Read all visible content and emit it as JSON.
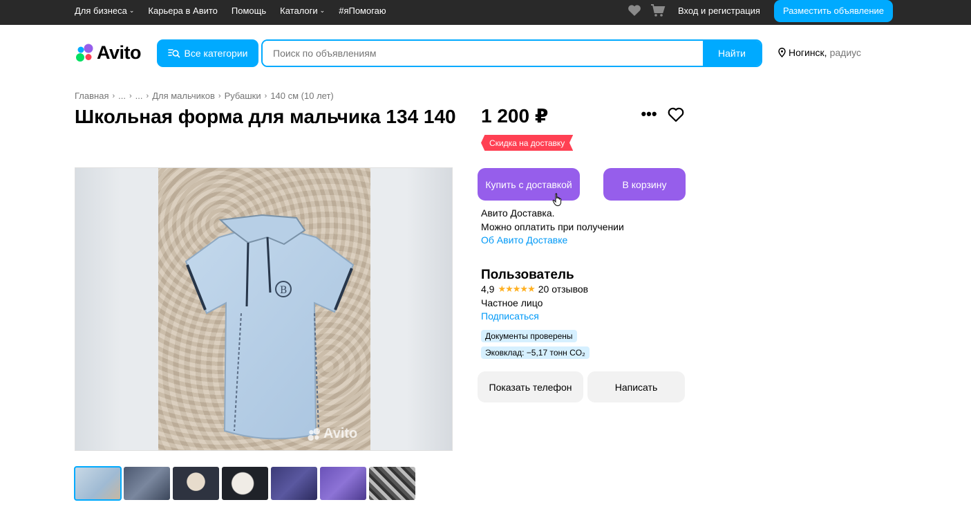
{
  "topbar": {
    "nav": [
      {
        "label": "Для бизнеса",
        "has_dropdown": true
      },
      {
        "label": "Карьера в Авито",
        "has_dropdown": false
      },
      {
        "label": "Помощь",
        "has_dropdown": false
      },
      {
        "label": "Каталоги",
        "has_dropdown": true
      },
      {
        "label": "#яПомогаю",
        "has_dropdown": false
      }
    ],
    "favorites_icon": "heart-icon",
    "cart_icon": "cart-icon",
    "login_label": "Вход и регистрация",
    "post_ad_label": "Разместить объявление"
  },
  "header": {
    "logo_text": "Avito",
    "categories_label": "Все категории",
    "search_placeholder": "Поиск по объявлениям",
    "search_button": "Найти",
    "location_city": "Ногинск,",
    "location_radius": "радиус"
  },
  "breadcrumbs": [
    "Главная",
    "...",
    "...",
    "Для мальчиков",
    "Рубашки",
    "140 см (10 лет)"
  ],
  "listing": {
    "title": "Школьная форма для мальчика 134 140",
    "watermark": "Avito",
    "thumbnail_count": 7
  },
  "offer": {
    "price": "1 200 ₽",
    "discount_badge": "Скидка на доставку",
    "buy_button": "Купить с доставкой",
    "cart_button": "В корзину",
    "delivery_line1": "Авито Доставка.",
    "delivery_line2": "Можно оплатить при получении",
    "delivery_link": "Об Авито Доставке"
  },
  "seller": {
    "name": "Пользователь",
    "rating": "4,9",
    "stars": "★★★★★",
    "reviews": "20 отзывов",
    "type": "Частное лицо",
    "subscribe": "Подписаться",
    "badges": [
      "Документы проверены",
      "Эковклад: −5,17 тонн CO₂"
    ],
    "phone_button": "Показать телефон",
    "message_button": "Написать"
  },
  "colors": {
    "topbar": "#292929",
    "accent_blue": "#00aaff",
    "purple": "#965eeb",
    "discount_red": "#ff4053",
    "link": "#0099f7"
  }
}
